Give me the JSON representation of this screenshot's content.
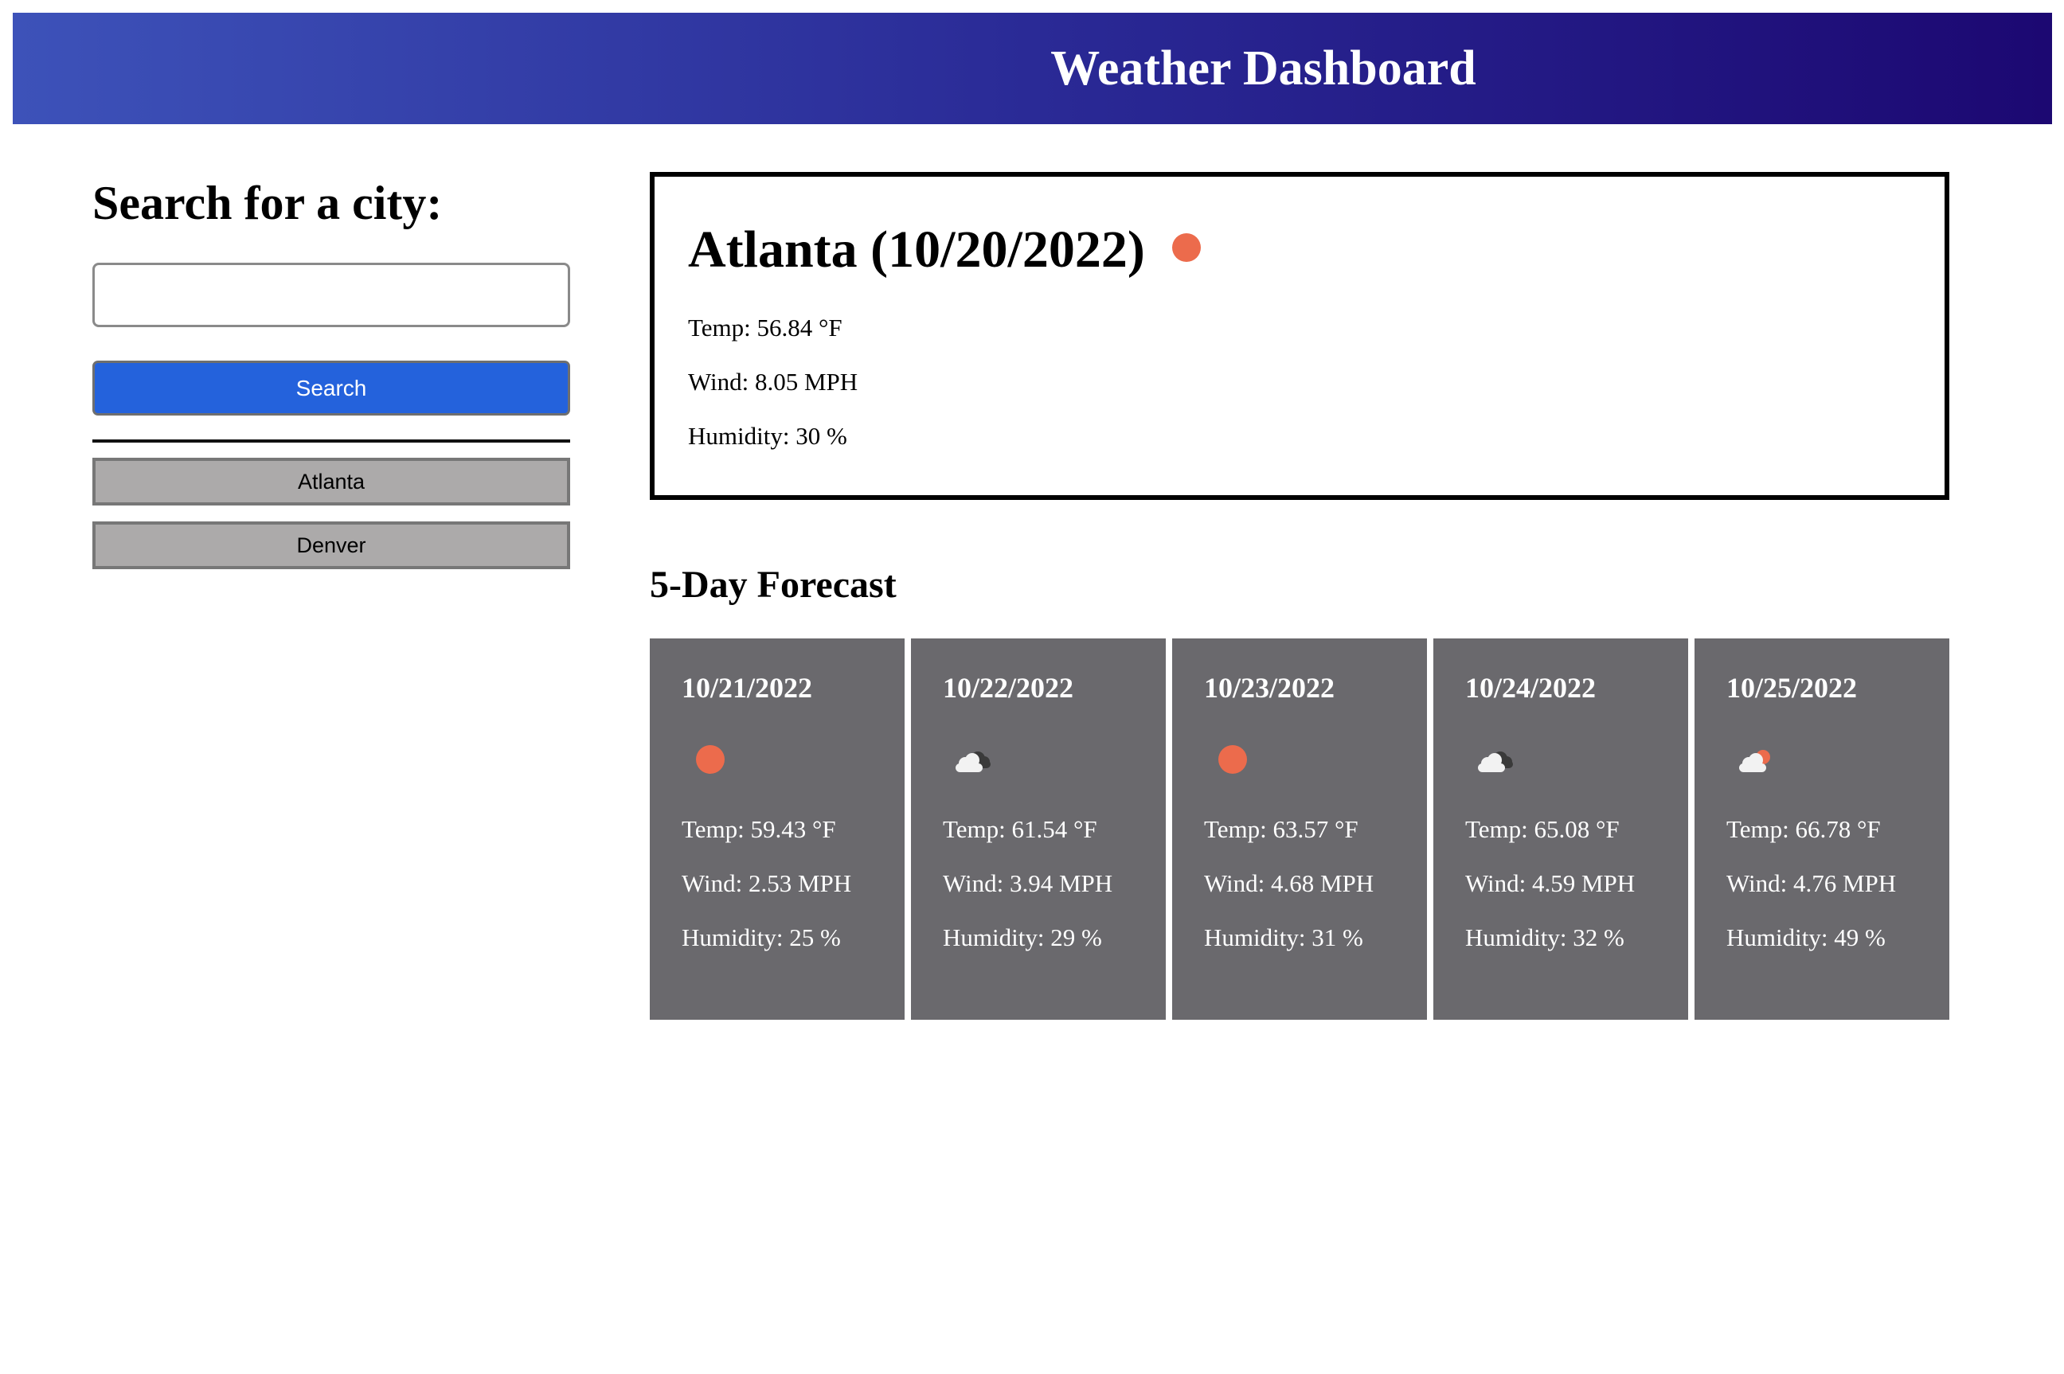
{
  "header": {
    "title": "Weather Dashboard"
  },
  "search": {
    "heading": "Search for a city:",
    "input_value": "",
    "input_placeholder": "",
    "button_label": "Search"
  },
  "history": [
    {
      "label": "Atlanta"
    },
    {
      "label": "Denver"
    }
  ],
  "current": {
    "title": "Atlanta (10/20/2022)",
    "icon": "sun-icon",
    "temp": "Temp: 56.84 °F",
    "wind": "Wind: 8.05 MPH",
    "humidity": "Humidity: 30 %"
  },
  "forecast": {
    "heading": "5-Day Forecast",
    "days": [
      {
        "date": "10/21/2022",
        "icon": "sun-icon",
        "temp": "Temp: 59.43 °F",
        "wind": "Wind: 2.53 MPH",
        "humidity": "Humidity: 25 %"
      },
      {
        "date": "10/22/2022",
        "icon": "cloud-icon",
        "temp": "Temp: 61.54 °F",
        "wind": "Wind: 3.94 MPH",
        "humidity": "Humidity: 29 %"
      },
      {
        "date": "10/23/2022",
        "icon": "sun-icon",
        "temp": "Temp: 63.57 °F",
        "wind": "Wind: 4.68 MPH",
        "humidity": "Humidity: 31 %"
      },
      {
        "date": "10/24/2022",
        "icon": "cloud-icon",
        "temp": "Temp: 65.08 °F",
        "wind": "Wind: 4.59 MPH",
        "humidity": "Humidity: 32 %"
      },
      {
        "date": "10/25/2022",
        "icon": "partly-cloudy-icon",
        "temp": "Temp: 66.78 °F",
        "wind": "Wind: 4.76 MPH",
        "humidity": "Humidity: 49 %"
      }
    ]
  },
  "colors": {
    "header_gradient_start": "#3d52b9",
    "header_gradient_end": "#1c0872",
    "search_button": "#2462dc",
    "history_button": "#acaaaa",
    "forecast_card": "#6a696d",
    "sun": "#ec6b4c"
  }
}
